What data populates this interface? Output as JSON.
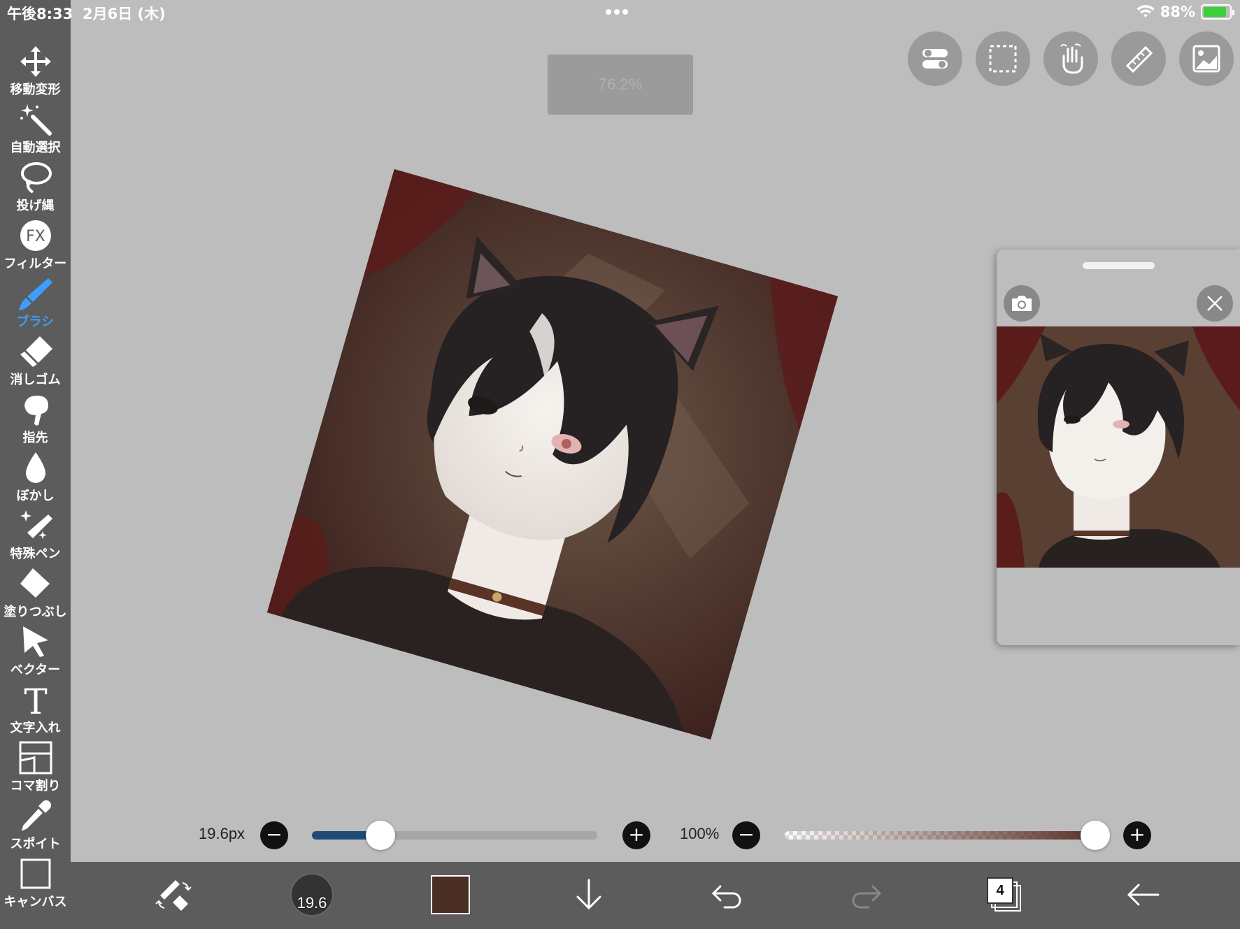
{
  "status_bar": {
    "time": "午後8:33",
    "date": "2月6日 (木)",
    "battery_percent": "88%",
    "battery_level": 0.88
  },
  "toolbar": {
    "items": [
      {
        "label": "移動変形",
        "icon": "move-transform-icon",
        "active": false
      },
      {
        "label": "自動選択",
        "icon": "magic-wand-icon",
        "active": false
      },
      {
        "label": "投げ縄",
        "icon": "lasso-icon",
        "active": false
      },
      {
        "label": "フィルター",
        "icon": "fx-filter-icon",
        "active": false
      },
      {
        "label": "ブラシ",
        "icon": "brush-icon",
        "active": true
      },
      {
        "label": "消しゴム",
        "icon": "eraser-icon",
        "active": false
      },
      {
        "label": "指先",
        "icon": "smudge-finger-icon",
        "active": false
      },
      {
        "label": "ぼかし",
        "icon": "blur-drop-icon",
        "active": false
      },
      {
        "label": "特殊ペン",
        "icon": "special-pen-icon",
        "active": false
      },
      {
        "label": "塗りつぶし",
        "icon": "fill-bucket-icon",
        "active": false
      },
      {
        "label": "ベクター",
        "icon": "vector-cursor-icon",
        "active": false
      },
      {
        "label": "文字入れ",
        "icon": "text-icon",
        "active": false
      },
      {
        "label": "コマ割り",
        "icon": "panel-layout-icon",
        "active": false
      },
      {
        "label": "スポイト",
        "icon": "eyedropper-icon",
        "active": false
      },
      {
        "label": "キャンバス",
        "icon": "canvas-icon",
        "active": false
      }
    ],
    "active_color": "#3d9eff"
  },
  "zoom": {
    "value": "76.2%"
  },
  "top_buttons": [
    "toggle-settings-icon",
    "selection-icon",
    "touch-gesture-icon",
    "ruler-icon",
    "material-image-icon"
  ],
  "brush": {
    "size_label": "19.6px",
    "size_fraction": 0.24,
    "opacity_label": "100%",
    "opacity_fraction": 1.0,
    "size_badge": "19.6",
    "color": "#4b2e23"
  },
  "layers": {
    "count": "4"
  },
  "colors": {
    "toolbar_bg": "#5c5c5c",
    "canvas_bg": "#bdbdbd",
    "size_slider_fill": "#1f4a78"
  }
}
